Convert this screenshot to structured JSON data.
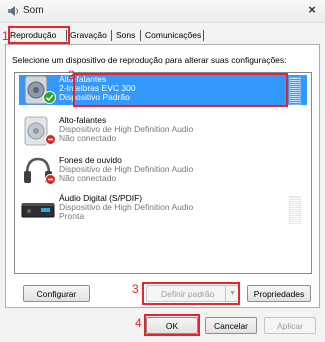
{
  "window": {
    "title": "Som",
    "close_symbol": "×"
  },
  "tabs": [
    {
      "label": "Reprodução",
      "active": true
    },
    {
      "label": "Gravação",
      "active": false
    },
    {
      "label": "Sons",
      "active": false
    },
    {
      "label": "Comunicações",
      "active": false
    }
  ],
  "instruction": "Selecione um dispositivo de reprodução para alterar suas configurações:",
  "devices": [
    {
      "name": "Alto-falantes",
      "detail": "2-Intelbras EVC 300",
      "status": "Dispositivo Padrão",
      "icon": "speaker-icon",
      "selected": true,
      "badge": "check-badge-icon"
    },
    {
      "name": "Alto-falantes",
      "detail": "Dispositivo de High Definition Audio",
      "status": "Não conectado",
      "icon": "speaker-icon",
      "selected": false,
      "badge": "disconnected-badge-icon"
    },
    {
      "name": "Fones de ouvido",
      "detail": "Dispositivo de High Definition Audio",
      "status": "Não conectado",
      "icon": "headphones-icon",
      "selected": false,
      "badge": "disconnected-badge-icon"
    },
    {
      "name": "Áudio Digital (S/PDIF)",
      "detail": "Dispositivo de High Definition Audio",
      "status": "Pronta",
      "icon": "digital-audio-icon",
      "selected": false,
      "badge": ""
    }
  ],
  "buttons": {
    "configure": "Configurar",
    "set_default": "Definir padrão",
    "properties": "Propriedades",
    "ok": "OK",
    "cancel": "Cancelar",
    "apply": "Aplicar"
  },
  "annotations": [
    "1",
    "2",
    "3",
    "4"
  ],
  "colors": {
    "selection": "#3399ff",
    "annotation": "#e8232f"
  }
}
